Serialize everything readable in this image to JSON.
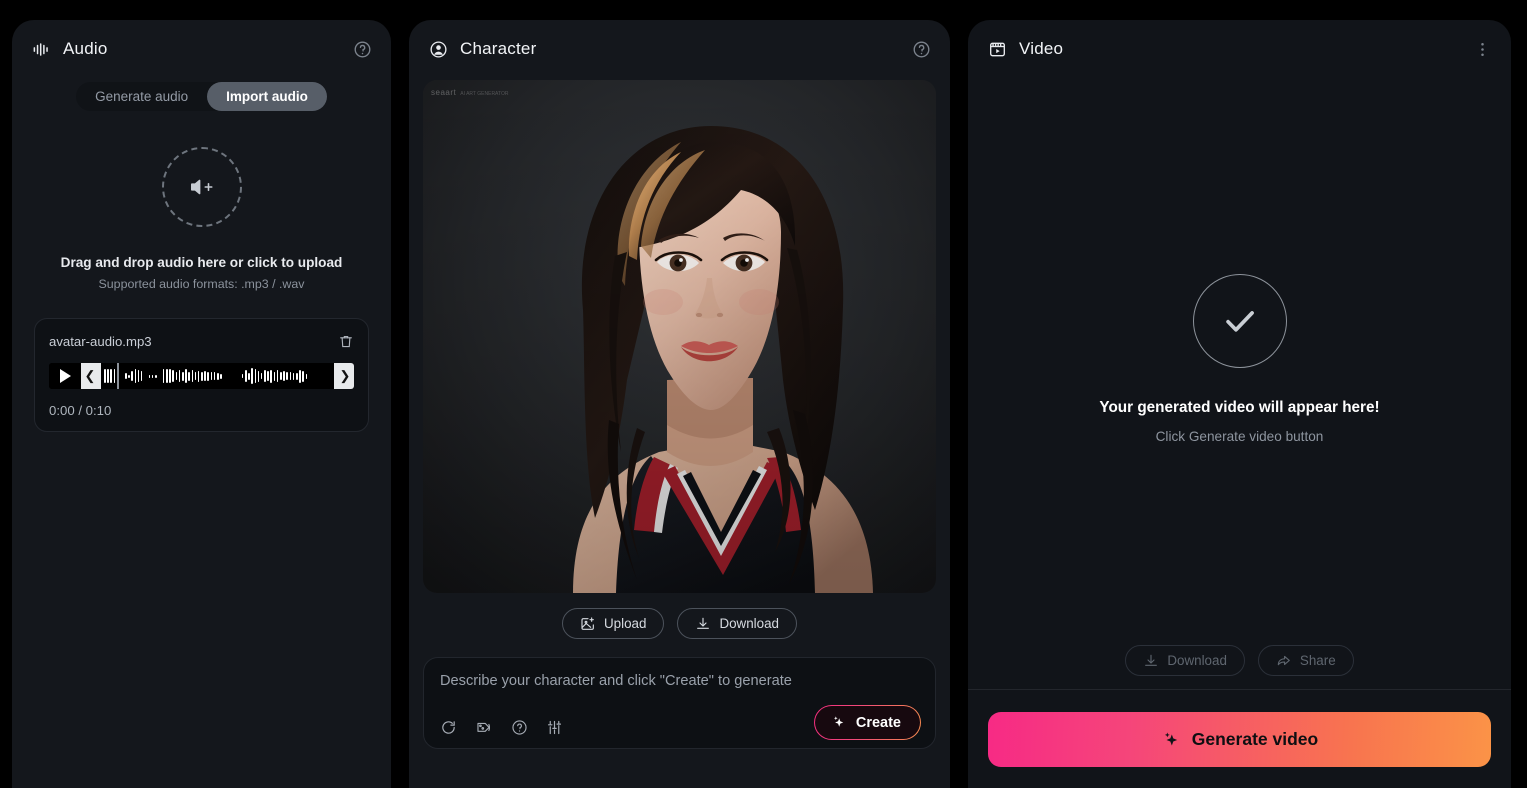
{
  "audio_panel": {
    "title": "Audio",
    "help_icon": "help-circle-icon",
    "header_icon": "audio-waveform-icon",
    "tabs": [
      {
        "label": "Generate audio",
        "active": false
      },
      {
        "label": "Import audio",
        "active": true
      }
    ],
    "dropzone": {
      "icon": "speaker-plus-icon",
      "main_text": "Drag and drop audio here or click to upload",
      "sub_text": "Supported audio formats: .mp3 / .wav"
    },
    "file": {
      "name": "avatar-audio.mp3",
      "delete_icon": "trash-icon",
      "play_icon": "play-icon",
      "prev_icon": "chevron-left-icon",
      "next_icon": "chevron-right-icon",
      "time": "0:00 / 0:10",
      "current_time": "0:00",
      "duration": "0:10"
    }
  },
  "character_panel": {
    "title": "Character",
    "header_icon": "user-circle-icon",
    "help_icon": "help-circle-icon",
    "image_watermark": "seaart",
    "image_watermark_sub": "AI ART GENERATOR",
    "buttons": [
      {
        "label": "Upload",
        "icon": "image-plus-icon"
      },
      {
        "label": "Download",
        "icon": "download-icon"
      }
    ],
    "prompt": {
      "placeholder": "Describe your character and click \"Create\" to generate",
      "value": "",
      "tools": [
        "refresh-icon",
        "style-reference-icon",
        "help-circle-icon",
        "sliders-icon"
      ],
      "create_label": "Create",
      "create_icon": "sparkle-icon"
    }
  },
  "video_panel": {
    "title": "Video",
    "header_icon": "video-clapper-icon",
    "menu_icon": "dots-vertical-icon",
    "placeholder": {
      "icon": "check-icon",
      "main_text": "Your generated video will appear here!",
      "sub_text": "Click Generate video button"
    },
    "actions": [
      {
        "label": "Download",
        "icon": "download-icon",
        "disabled": true
      },
      {
        "label": "Share",
        "icon": "share-icon",
        "disabled": true
      }
    ],
    "generate": {
      "label": "Generate video",
      "icon": "sparkle-icon"
    }
  },
  "colors": {
    "page_background": "#000000",
    "panel_background": "#14171c",
    "accent_gradient_start": "#f72a85",
    "accent_gradient_end": "#fb9347",
    "active_tab_background": "#575e68",
    "muted_text": "#8e959f"
  }
}
